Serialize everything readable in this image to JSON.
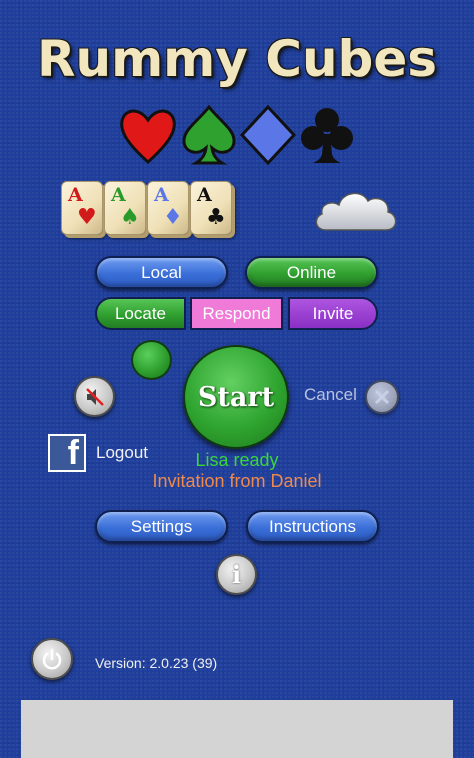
{
  "app": {
    "title": "Rummy Cubes"
  },
  "suits": [
    "heart-icon",
    "spade-icon",
    "diamond-icon",
    "club-icon"
  ],
  "tiles": [
    {
      "rank": "A",
      "suit": "hearts",
      "color": "#d11a1a"
    },
    {
      "rank": "A",
      "suit": "spades",
      "color": "#2a9a2a"
    },
    {
      "rank": "A",
      "suit": "diamonds",
      "color": "#5b76e6"
    },
    {
      "rank": "A",
      "suit": "clubs",
      "color": "#111111"
    }
  ],
  "mode": {
    "local_label": "Local",
    "online_label": "Online"
  },
  "actions": {
    "locate_label": "Locate",
    "respond_label": "Respond",
    "invite_label": "Invite"
  },
  "game": {
    "start_label": "Start",
    "cancel_label": "Cancel"
  },
  "facebook": {
    "logout_label": "Logout"
  },
  "status": {
    "ready_text": "Lisa ready",
    "invitation_text": "Invitation from Daniel"
  },
  "menu": {
    "settings_label": "Settings",
    "instructions_label": "Instructions"
  },
  "footer": {
    "version_text": "Version: 2.0.23 (39)"
  },
  "colors": {
    "background": "#1f3f9e",
    "ready": "#39d639",
    "invitation": "#f08a4b",
    "respond": "#f07ad8",
    "invite": "#9b3dd1"
  }
}
